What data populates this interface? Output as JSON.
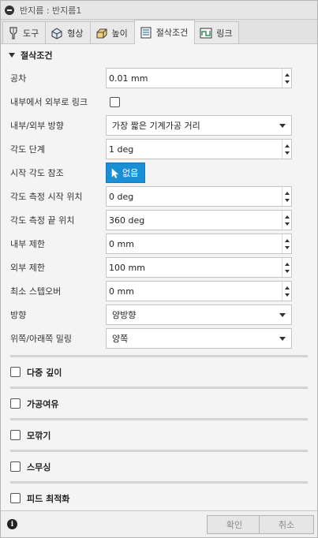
{
  "window": {
    "title": "반지름 : 반지름1"
  },
  "tabs": [
    {
      "label": "도구",
      "icon": "tool-icon"
    },
    {
      "label": "형상",
      "icon": "geometry-icon"
    },
    {
      "label": "높이",
      "icon": "height-icon"
    },
    {
      "label": "절삭조건",
      "icon": "passes-icon",
      "active": true
    },
    {
      "label": "링크",
      "icon": "linking-icon"
    }
  ],
  "section": {
    "title": "절삭조건"
  },
  "fields": {
    "tolerance": {
      "label": "공차",
      "value": "0.01 mm"
    },
    "link_inside_out": {
      "label": "내부에서 외부로 링크",
      "checked": false
    },
    "direction_inout": {
      "label": "내부/외부 방향",
      "value": "가장 짧은 기계가공 거리"
    },
    "angle_step": {
      "label": "각도 단계",
      "value": "1 deg"
    },
    "start_angle_ref": {
      "label": "시작 각도 참조",
      "button": "없음"
    },
    "angle_start": {
      "label": "각도 측정 시작 위치",
      "value": "0 deg"
    },
    "angle_end": {
      "label": "각도 측정 끝 위치",
      "value": "360 deg"
    },
    "inner_limit": {
      "label": "내부 제한",
      "value": "0 mm"
    },
    "outer_limit": {
      "label": "외부 제한",
      "value": "100 mm"
    },
    "min_stepover": {
      "label": "최소 스텝오버",
      "value": "0 mm"
    },
    "direction": {
      "label": "방향",
      "value": "양방향"
    },
    "up_down_milling": {
      "label": "위쪽/아래쪽 밀링",
      "value": "양쪽"
    }
  },
  "collapsed_sections": [
    {
      "label": "다중 깊이",
      "checked": false
    },
    {
      "label": "가공여유",
      "checked": false
    },
    {
      "label": "모깎기",
      "checked": false
    },
    {
      "label": "스무싱",
      "checked": false
    },
    {
      "label": "피드 최적화",
      "checked": false
    }
  ],
  "footer": {
    "info": "i",
    "ok": "확인",
    "cancel": "취소"
  },
  "colors": {
    "accent": "#1a8fd6"
  }
}
